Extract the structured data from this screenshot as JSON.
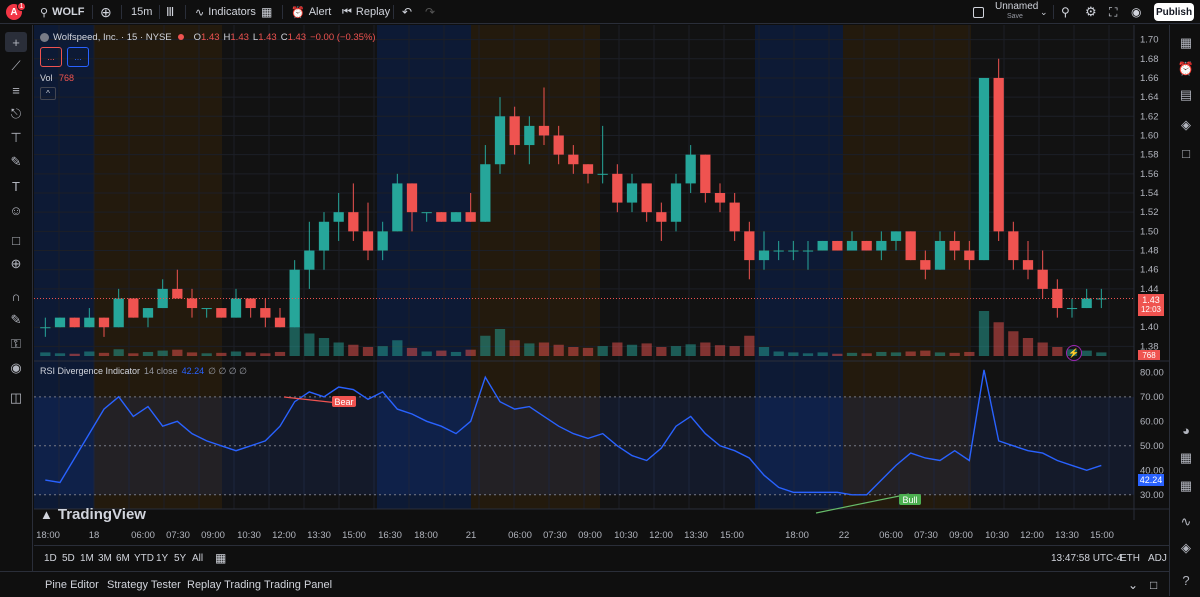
{
  "topbar": {
    "avatar_letter": "A",
    "notif_count": "1",
    "symbol": "WOLF",
    "interval": "15m",
    "indicators_label": "Indicators",
    "alert_label": "Alert",
    "replay_label": "Replay",
    "layout_name": "Unnamed",
    "save_label": "Save",
    "publish_label": "Publish"
  },
  "legend": {
    "title": "Wolfspeed, Inc. · 15 · NYSE",
    "o_label": "O",
    "o": "1.43",
    "h_label": "H",
    "h": "1.43",
    "l_label": "L",
    "l": "1.43",
    "c_label": "C",
    "c": "1.43",
    "change": "−0.00 (−0.35%)",
    "btn1": "...",
    "btn2": "...",
    "vol_label": "Vol",
    "vol_value": "768",
    "collapse": "^"
  },
  "rsi_legend": {
    "name": "RSI Divergence Indicator",
    "params": "14 close",
    "value": "42.24",
    "extra": "∅ ∅ ∅ ∅"
  },
  "price_axis": {
    "ticks": [
      "1.70",
      "1.68",
      "1.66",
      "1.64",
      "1.62",
      "1.60",
      "1.58",
      "1.56",
      "1.54",
      "1.52",
      "1.50",
      "1.48",
      "1.46",
      "1.44",
      "1.40",
      "1.38"
    ],
    "last_price": "1.43",
    "countdown": "12:03",
    "volume_tag": "768"
  },
  "rsi_axis": {
    "ticks": [
      "80.00",
      "70.00",
      "60.00",
      "50.00",
      "40.00",
      "30.00"
    ],
    "current": "42.24"
  },
  "time_axis": {
    "ticks": [
      "18:00",
      "18",
      "06:00",
      "07:30",
      "09:00",
      "10:30",
      "12:00",
      "13:30",
      "15:00",
      "16:30",
      "18:00",
      "21",
      "06:00",
      "07:30",
      "09:00",
      "10:30",
      "12:00",
      "13:30",
      "15:00",
      "18:00",
      "22",
      "06:00",
      "07:30",
      "09:00",
      "10:30",
      "12:00",
      "13:30",
      "15:00"
    ]
  },
  "annotations": {
    "bear": "Bear",
    "bull": "Bull"
  },
  "watermark": "TradingView",
  "range_bar": {
    "ranges": [
      "1D",
      "5D",
      "1M",
      "3M",
      "6M",
      "YTD",
      "1Y",
      "5Y",
      "All"
    ],
    "clock": "13:47:58 UTC-4",
    "eth": "ETH",
    "adj": "ADJ"
  },
  "footer": {
    "tabs": [
      "Pine Editor",
      "Strategy Tester",
      "Replay Trading",
      "Trading Panel"
    ]
  },
  "colors": {
    "up": "#26a69a",
    "down": "#ef5350",
    "rsi_line": "#2962ff",
    "accent": "#2962ff"
  },
  "chart_data": {
    "type": "candlestick",
    "title": "Wolfspeed, Inc. · 15 · NYSE",
    "price_ylim": [
      1.37,
      1.71
    ],
    "rsi_ylim": [
      25,
      83
    ],
    "rsi_levels": [
      70,
      50,
      30
    ],
    "price_ohlc": [
      [
        1.4,
        1.41,
        1.39,
        1.4
      ],
      [
        1.4,
        1.41,
        1.4,
        1.41
      ],
      [
        1.41,
        1.41,
        1.4,
        1.4
      ],
      [
        1.4,
        1.42,
        1.4,
        1.41
      ],
      [
        1.41,
        1.41,
        1.39,
        1.4
      ],
      [
        1.4,
        1.44,
        1.4,
        1.43
      ],
      [
        1.43,
        1.43,
        1.41,
        1.41
      ],
      [
        1.41,
        1.42,
        1.4,
        1.42
      ],
      [
        1.42,
        1.45,
        1.42,
        1.44
      ],
      [
        1.44,
        1.46,
        1.43,
        1.43
      ],
      [
        1.43,
        1.44,
        1.41,
        1.42
      ],
      [
        1.42,
        1.42,
        1.41,
        1.42
      ],
      [
        1.42,
        1.42,
        1.41,
        1.41
      ],
      [
        1.41,
        1.44,
        1.41,
        1.43
      ],
      [
        1.43,
        1.43,
        1.41,
        1.42
      ],
      [
        1.42,
        1.43,
        1.4,
        1.41
      ],
      [
        1.41,
        1.42,
        1.4,
        1.4
      ],
      [
        1.4,
        1.47,
        1.4,
        1.46
      ],
      [
        1.46,
        1.51,
        1.44,
        1.48
      ],
      [
        1.48,
        1.52,
        1.46,
        1.51
      ],
      [
        1.51,
        1.54,
        1.49,
        1.52
      ],
      [
        1.52,
        1.55,
        1.49,
        1.5
      ],
      [
        1.5,
        1.53,
        1.47,
        1.48
      ],
      [
        1.48,
        1.51,
        1.47,
        1.5
      ],
      [
        1.5,
        1.56,
        1.5,
        1.55
      ],
      [
        1.55,
        1.55,
        1.5,
        1.52
      ],
      [
        1.52,
        1.52,
        1.51,
        1.52
      ],
      [
        1.52,
        1.52,
        1.51,
        1.51
      ],
      [
        1.51,
        1.52,
        1.51,
        1.52
      ],
      [
        1.52,
        1.54,
        1.51,
        1.51
      ],
      [
        1.51,
        1.59,
        1.51,
        1.57
      ],
      [
        1.57,
        1.64,
        1.56,
        1.62
      ],
      [
        1.62,
        1.63,
        1.58,
        1.59
      ],
      [
        1.59,
        1.62,
        1.57,
        1.61
      ],
      [
        1.61,
        1.65,
        1.59,
        1.6
      ],
      [
        1.6,
        1.61,
        1.57,
        1.58
      ],
      [
        1.58,
        1.59,
        1.56,
        1.57
      ],
      [
        1.57,
        1.57,
        1.55,
        1.56
      ],
      [
        1.56,
        1.61,
        1.55,
        1.56
      ],
      [
        1.56,
        1.57,
        1.52,
        1.53
      ],
      [
        1.53,
        1.56,
        1.52,
        1.55
      ],
      [
        1.55,
        1.55,
        1.51,
        1.52
      ],
      [
        1.52,
        1.53,
        1.49,
        1.51
      ],
      [
        1.51,
        1.56,
        1.5,
        1.55
      ],
      [
        1.55,
        1.59,
        1.54,
        1.58
      ],
      [
        1.58,
        1.58,
        1.53,
        1.54
      ],
      [
        1.54,
        1.55,
        1.52,
        1.53
      ],
      [
        1.53,
        1.54,
        1.49,
        1.5
      ],
      [
        1.5,
        1.51,
        1.45,
        1.47
      ],
      [
        1.47,
        1.5,
        1.46,
        1.48
      ],
      [
        1.48,
        1.49,
        1.47,
        1.48
      ],
      [
        1.48,
        1.49,
        1.47,
        1.48
      ],
      [
        1.48,
        1.49,
        1.46,
        1.48
      ],
      [
        1.48,
        1.49,
        1.48,
        1.49
      ],
      [
        1.49,
        1.49,
        1.48,
        1.48
      ],
      [
        1.48,
        1.5,
        1.48,
        1.49
      ],
      [
        1.49,
        1.49,
        1.48,
        1.48
      ],
      [
        1.48,
        1.5,
        1.47,
        1.49
      ],
      [
        1.49,
        1.5,
        1.48,
        1.5
      ],
      [
        1.5,
        1.5,
        1.47,
        1.47
      ],
      [
        1.47,
        1.48,
        1.45,
        1.46
      ],
      [
        1.46,
        1.5,
        1.46,
        1.49
      ],
      [
        1.49,
        1.5,
        1.47,
        1.48
      ],
      [
        1.48,
        1.49,
        1.46,
        1.47
      ],
      [
        1.47,
        1.58,
        1.47,
        1.66
      ],
      [
        1.66,
        1.68,
        1.49,
        1.5
      ],
      [
        1.5,
        1.51,
        1.46,
        1.47
      ],
      [
        1.47,
        1.49,
        1.45,
        1.46
      ],
      [
        1.46,
        1.48,
        1.43,
        1.44
      ],
      [
        1.44,
        1.45,
        1.41,
        1.42
      ],
      [
        1.42,
        1.43,
        1.41,
        1.42
      ],
      [
        1.42,
        1.44,
        1.42,
        1.43
      ],
      [
        1.43,
        1.44,
        1.42,
        1.43
      ]
    ],
    "volume": [
      8,
      6,
      5,
      10,
      7,
      15,
      6,
      9,
      12,
      14,
      8,
      6,
      7,
      10,
      8,
      6,
      9,
      70,
      50,
      40,
      30,
      25,
      20,
      22,
      35,
      18,
      10,
      12,
      9,
      14,
      45,
      60,
      35,
      28,
      30,
      25,
      20,
      18,
      22,
      30,
      25,
      28,
      20,
      22,
      26,
      30,
      24,
      22,
      45,
      20,
      10,
      8,
      6,
      8,
      5,
      7,
      6,
      9,
      8,
      10,
      12,
      8,
      7,
      9,
      100,
      75,
      55,
      40,
      30,
      20,
      15,
      12,
      8
    ],
    "rsi": [
      36,
      35,
      45,
      55,
      65,
      70,
      62,
      66,
      58,
      60,
      55,
      52,
      50,
      48,
      50,
      52,
      58,
      68,
      72,
      70,
      74,
      73,
      69,
      72,
      65,
      63,
      60,
      58,
      55,
      60,
      78,
      68,
      65,
      66,
      62,
      58,
      55,
      53,
      55,
      50,
      46,
      44,
      49,
      58,
      62,
      55,
      50,
      48,
      45,
      38,
      33,
      31,
      31,
      31,
      31,
      30,
      30,
      36,
      42,
      47,
      45,
      44,
      48,
      44,
      81,
      52,
      50,
      48,
      47,
      44,
      42,
      40,
      42
    ]
  },
  "candle_series": "Wolfspeed, Inc."
}
